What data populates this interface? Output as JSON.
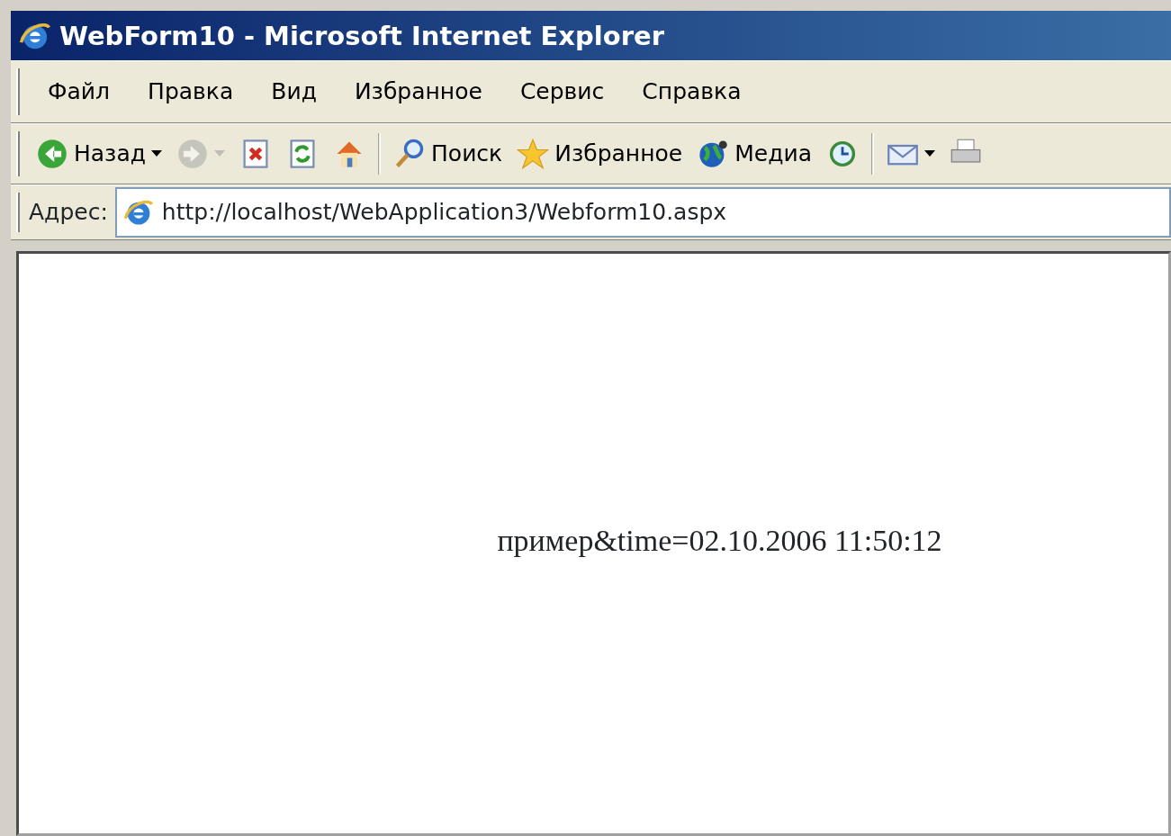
{
  "window": {
    "title": "WebForm10 - Microsoft Internet Explorer"
  },
  "menu": [
    {
      "label": "Файл"
    },
    {
      "label": "Правка"
    },
    {
      "label": "Вид"
    },
    {
      "label": "Избранное"
    },
    {
      "label": "Сервис"
    },
    {
      "label": "Справка"
    }
  ],
  "toolbar": [
    {
      "kind": "back",
      "label": "Назад",
      "disabled": false,
      "dropdown": true
    },
    {
      "kind": "forward",
      "disabled": true,
      "dropdown": true
    },
    {
      "kind": "stop",
      "disabled": false,
      "dropdown": false
    },
    {
      "kind": "refresh",
      "disabled": false,
      "dropdown": false
    },
    {
      "kind": "home",
      "disabled": false,
      "dropdown": false
    },
    {
      "kind": "separator"
    },
    {
      "kind": "search",
      "label": "Поиск",
      "disabled": false,
      "dropdown": false
    },
    {
      "kind": "favorites",
      "label": "Избранное",
      "disabled": false,
      "dropdown": false
    },
    {
      "kind": "media",
      "label": "Медиа",
      "disabled": false,
      "dropdown": false
    },
    {
      "kind": "history",
      "disabled": false,
      "dropdown": false
    },
    {
      "kind": "separator"
    },
    {
      "kind": "mail",
      "disabled": false,
      "dropdown": true
    },
    {
      "kind": "print",
      "disabled": false,
      "dropdown": false
    }
  ],
  "address_bar": {
    "label": "Адрес:",
    "value": "http://localhost/WebApplication3/Webform10.aspx"
  },
  "page": {
    "text": "пример&time=02.10.2006 11:50:12"
  }
}
